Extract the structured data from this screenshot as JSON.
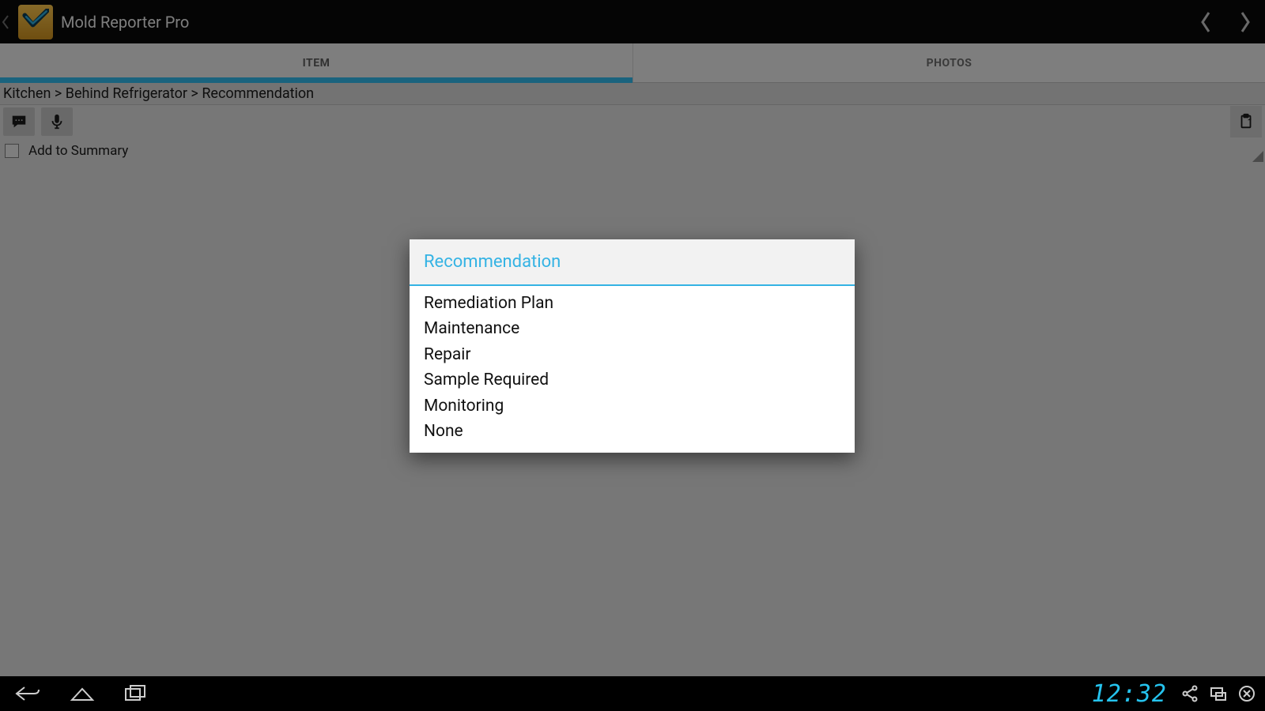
{
  "header": {
    "title": "Mold Reporter Pro"
  },
  "tabs": {
    "item": "ITEM",
    "photos": "PHOTOS",
    "active_index": 0
  },
  "breadcrumb": "Kitchen > Behind Refrigerator > Recommendation",
  "toolbar": {
    "add_to_summary_label": "Add to Summary",
    "add_to_summary_checked": false
  },
  "dialog": {
    "title": "Recommendation",
    "options": {
      "o0": "Remediation Plan",
      "o1": "Maintenance",
      "o2": "Repair",
      "o3": "Sample Required",
      "o4": "Monitoring",
      "o5": "None"
    }
  },
  "system": {
    "clock": "12:32"
  },
  "colors": {
    "accent": "#30b5e6",
    "dialog_accent": "#34b3e4",
    "clock": "#25c3ee"
  },
  "icons": {
    "back_chevron": "chevron-left-icon",
    "app": "checkmark-shield-icon",
    "prev": "chevron-left-icon",
    "next": "chevron-right-icon",
    "comment": "speech-bubble-icon",
    "mic": "microphone-icon",
    "clipboard": "clipboard-icon",
    "nav_back": "back-icon",
    "nav_home": "home-icon",
    "nav_recent": "recent-apps-icon",
    "share": "share-icon",
    "screen": "screen-icon",
    "close": "close-circle-icon"
  }
}
